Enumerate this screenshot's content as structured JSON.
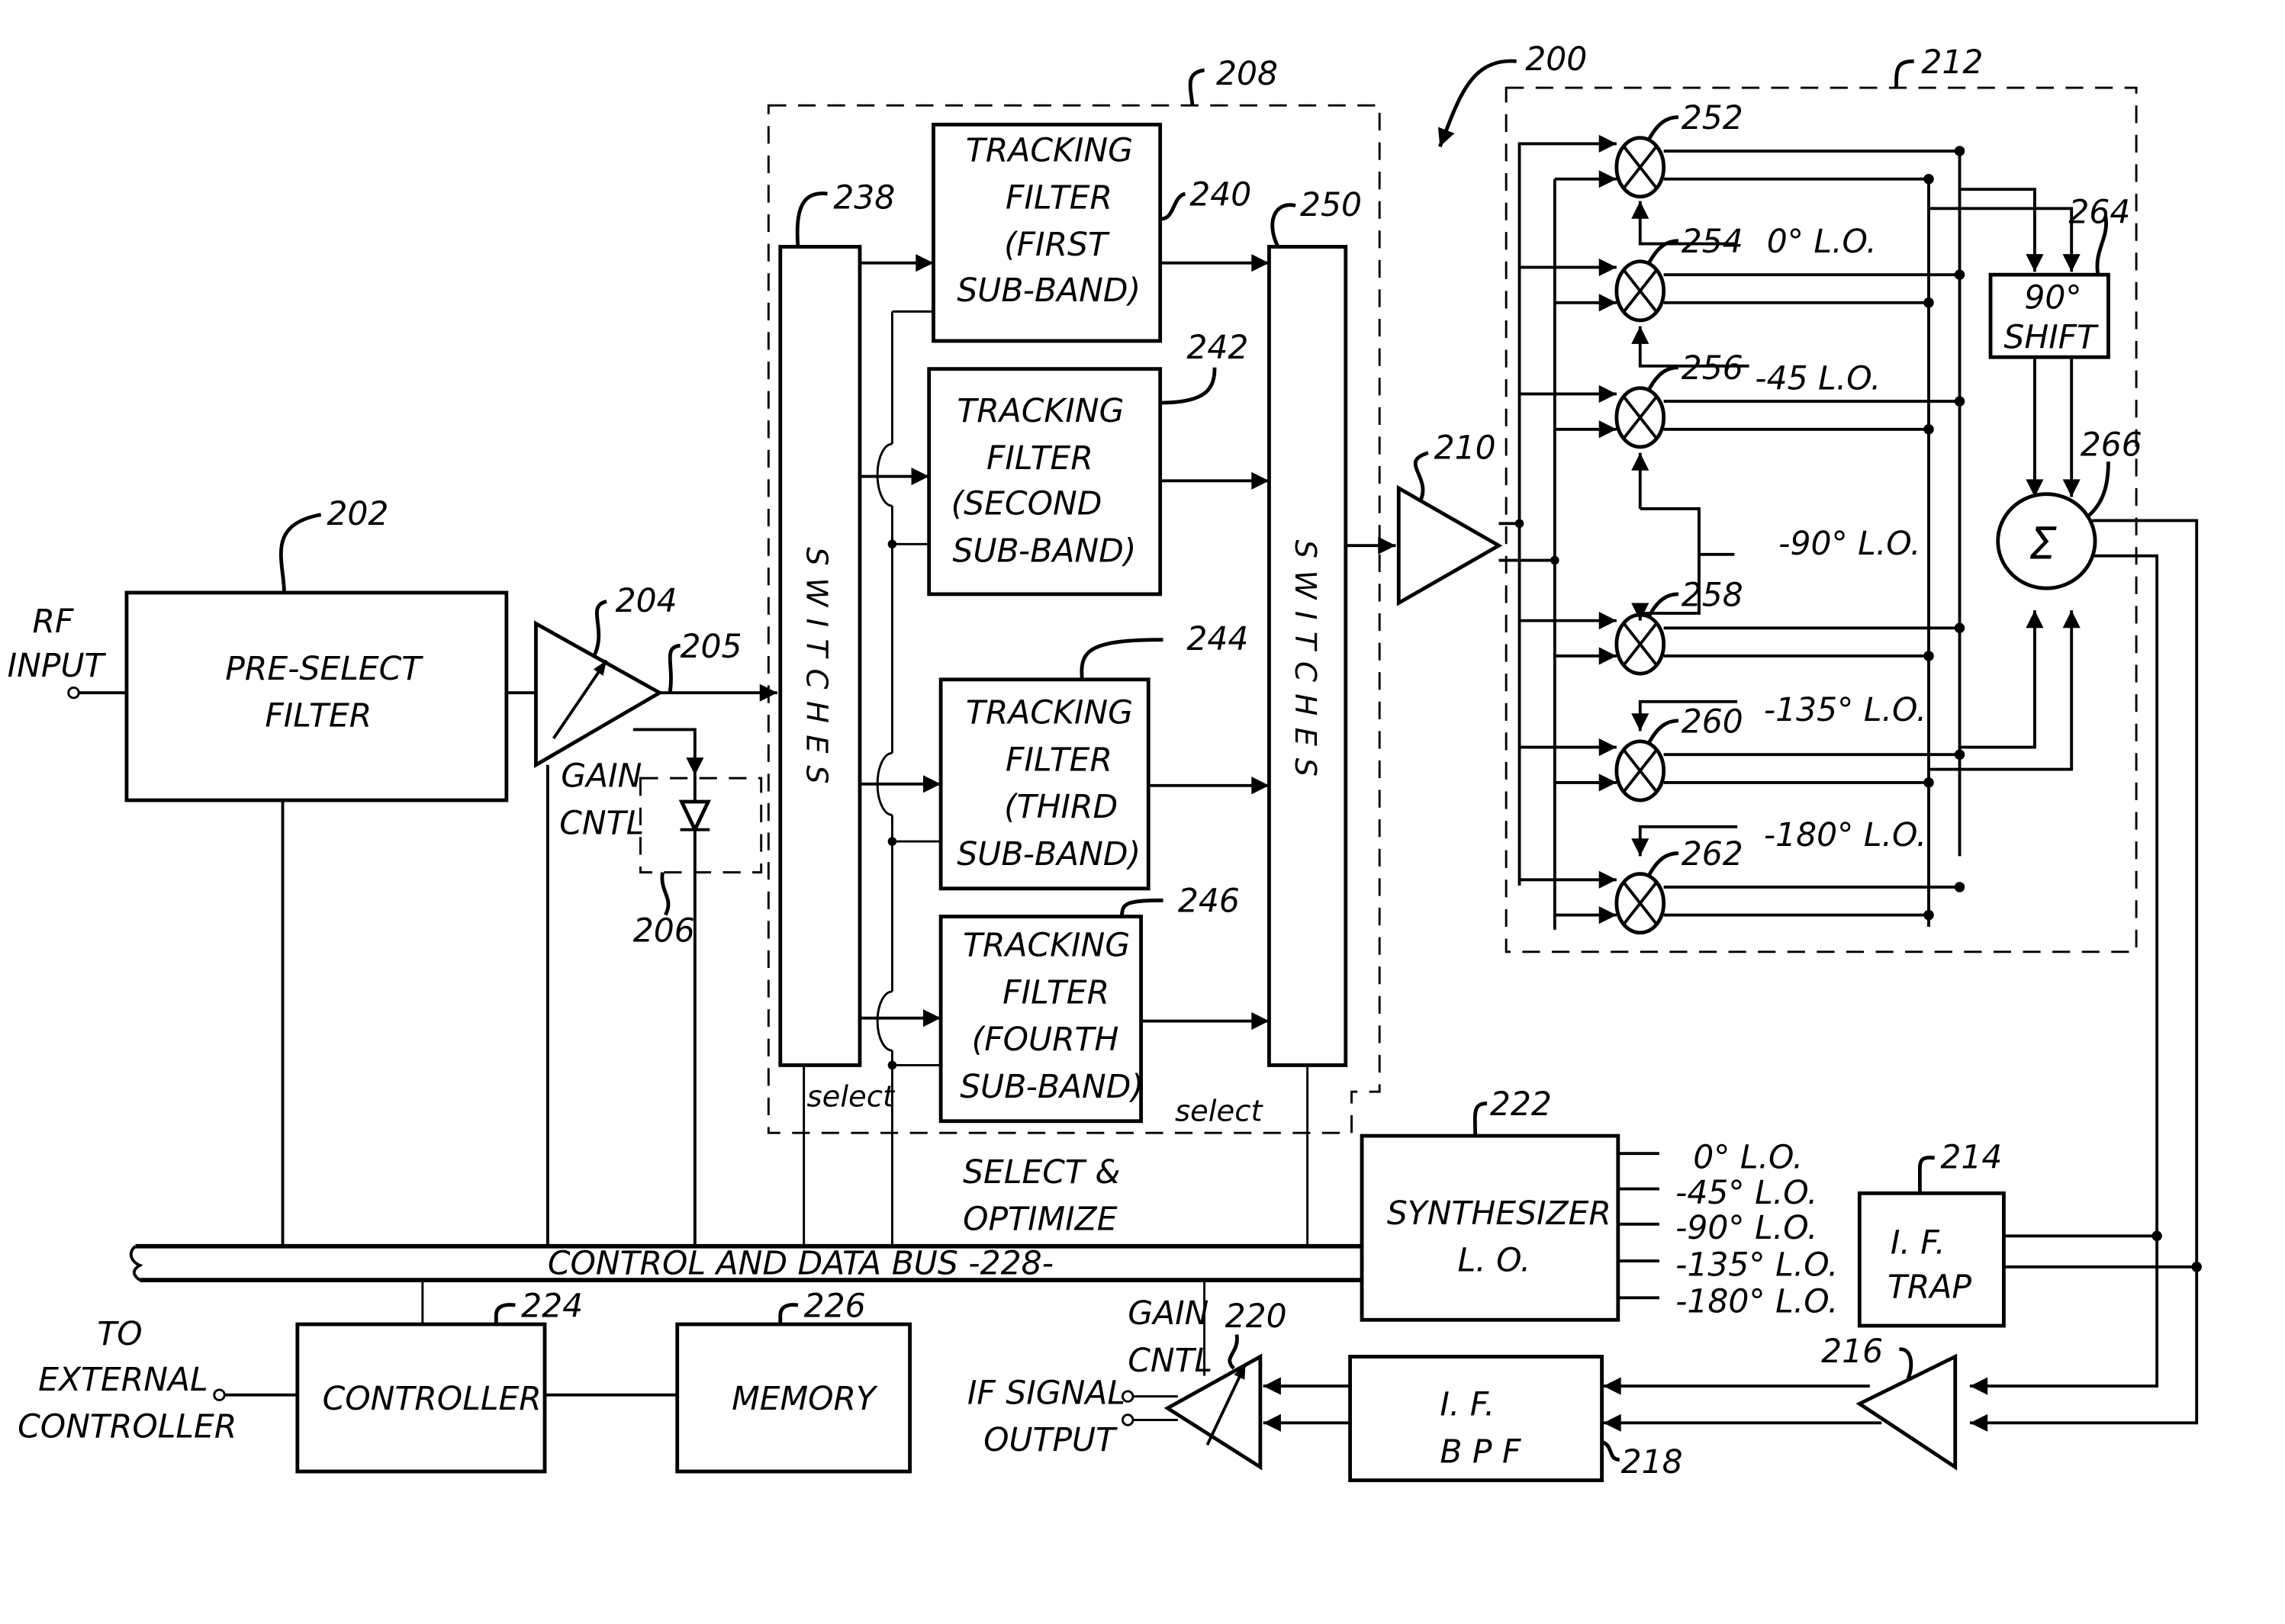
{
  "figure": {
    "ref": "200",
    "rf_input": [
      "RF",
      "INPUT"
    ],
    "preselect_filter": {
      "ref": "202",
      "lines": [
        "PRE-SELECT",
        "FILTER"
      ]
    },
    "amp_204": {
      "ref": "204",
      "node_ref": "205",
      "gain_label": [
        "GAIN",
        "CNTL"
      ]
    },
    "detector_206": {
      "ref": "206"
    },
    "select_block": {
      "ref": "208",
      "switches_in": {
        "ref": "238",
        "label": "SWITCHES",
        "select": "select"
      },
      "switches_out": {
        "ref": "250",
        "label": "SWITCHES",
        "select": "select"
      },
      "filters": [
        {
          "ref": "240",
          "lines": [
            "TRACKING",
            "FILTER",
            "(FIRST",
            "SUB-BAND)"
          ]
        },
        {
          "ref": "242",
          "lines": [
            "TRACKING",
            "FILTER",
            "(SECOND",
            "SUB-BAND)"
          ]
        },
        {
          "ref": "244",
          "lines": [
            "TRACKING",
            "FILTER",
            "(THIRD",
            "SUB-BAND)"
          ]
        },
        {
          "ref": "246",
          "lines": [
            "TRACKING",
            "FILTER",
            "(FOURTH",
            "SUB-BAND)"
          ]
        }
      ],
      "caption": [
        "SELECT &",
        "OPTIMIZE"
      ]
    },
    "amp_210": {
      "ref": "210"
    },
    "mixer_block": {
      "ref": "212",
      "mixers": [
        "252",
        "254",
        "256",
        "258",
        "260",
        "262"
      ],
      "lo_labels": [
        "0° L.O.",
        "-45 L.O.",
        "-90° L.O.",
        "-135° L.O.",
        "-180° L.O."
      ],
      "shift": {
        "ref": "264",
        "lines": [
          "90°",
          "SHIFT"
        ]
      },
      "summer": {
        "ref": "266",
        "symbol": "Σ"
      }
    },
    "if_trap": {
      "ref": "214",
      "lines": [
        "I. F.",
        "TRAP"
      ]
    },
    "amp_216": {
      "ref": "216"
    },
    "if_bpf": {
      "ref": "218",
      "lines": [
        "I. F.",
        "B P F"
      ]
    },
    "amp_220": {
      "ref": "220",
      "gain_label": [
        "GAIN",
        "CNTL"
      ]
    },
    "if_output": [
      "IF SIGNAL",
      "OUTPUT"
    ],
    "synthesizer": {
      "ref": "222",
      "lines": [
        "SYNTHESIZER",
        "L. O."
      ],
      "outputs": [
        "0° L.O.",
        "-45° L.O.",
        "-90° L.O.",
        "-135° L.O.",
        "-180° L.O."
      ]
    },
    "controller": {
      "ref": "224",
      "label": "CONTROLLER"
    },
    "memory": {
      "ref": "226",
      "label": "MEMORY"
    },
    "external": [
      "TO",
      "EXTERNAL",
      "CONTROLLER"
    ],
    "bus": {
      "label": "CONTROL AND DATA BUS  -228-"
    }
  }
}
